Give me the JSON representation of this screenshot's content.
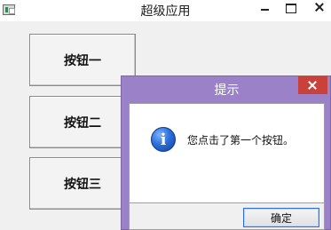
{
  "window": {
    "title": "超级应用",
    "controls": [
      "minimize",
      "maximize",
      "close"
    ]
  },
  "buttons": [
    {
      "label": "按钮一"
    },
    {
      "label": "按钮二"
    },
    {
      "label": "按钮三"
    }
  ],
  "dialog": {
    "title": "提示",
    "icon": "info-icon",
    "message": "您点击了第一个按钮。",
    "ok_label": "确定"
  },
  "colors": {
    "dialog_frame": "#9b82c8",
    "dialog_close": "#c9413a",
    "ok_focus_border": "#2f6fd6"
  }
}
